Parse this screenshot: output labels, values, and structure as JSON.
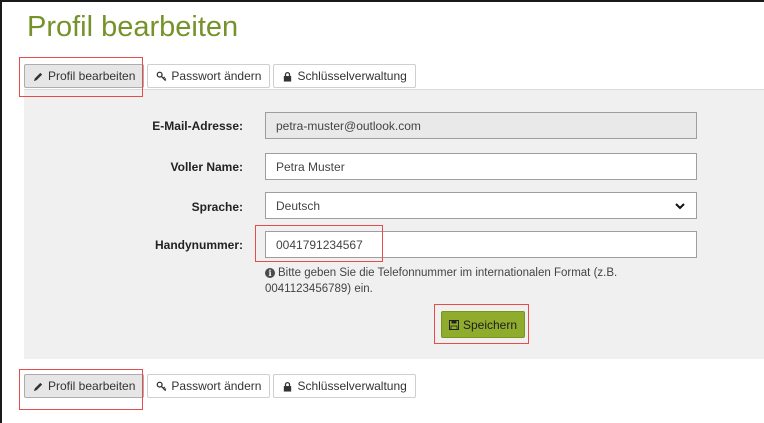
{
  "page": {
    "title": "Profil bearbeiten"
  },
  "tabs": [
    {
      "label": "Profil bearbeiten",
      "icon": "pencil-icon",
      "active": true
    },
    {
      "label": "Passwort ändern",
      "icon": "key-icon",
      "active": false
    },
    {
      "label": "Schlüsselverwaltung",
      "icon": "lock-icon",
      "active": false
    }
  ],
  "form": {
    "email": {
      "label": "E-Mail-Adresse:",
      "value": "petra-muster@outlook.com"
    },
    "name": {
      "label": "Voller Name:",
      "value": "Petra Muster"
    },
    "language": {
      "label": "Sprache:",
      "value": "Deutsch"
    },
    "phone": {
      "label": "Handynummer:",
      "value": "0041791234567"
    },
    "help_text": "Bitte geben Sie die Telefonnummer im internationalen Format (z.B. 0041123456789) ein.",
    "save_label": "Speichern"
  },
  "colors": {
    "accent": "#76922b",
    "button": "#90ac2c",
    "highlight": "#e84b4b"
  }
}
